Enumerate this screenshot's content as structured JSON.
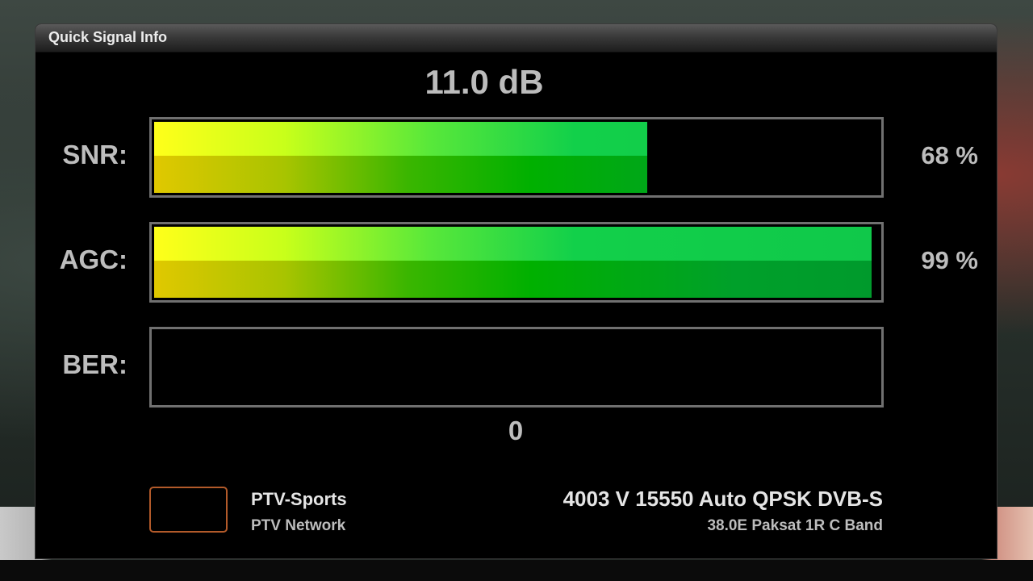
{
  "window": {
    "title": "Quick Signal Info"
  },
  "snr_db": "11.0 dB",
  "snr": {
    "label": "SNR:",
    "percent_text": "68 %",
    "level": 0.68
  },
  "agc": {
    "label": "AGC:",
    "percent_text": "99 %",
    "level": 0.99
  },
  "ber": {
    "label": "BER:",
    "value": "0",
    "level": 0
  },
  "service": {
    "name": "PTV-Sports",
    "provider": "PTV Network",
    "transponder": "4003 V 15550 Auto QPSK DVB-S",
    "satellite": "38.0E Paksat 1R C Band"
  },
  "colors": {
    "bar_start": "#ffff1a",
    "bar_end": "#10c84a",
    "logo_border": "#b25a2a",
    "bar_border": "#707070"
  }
}
